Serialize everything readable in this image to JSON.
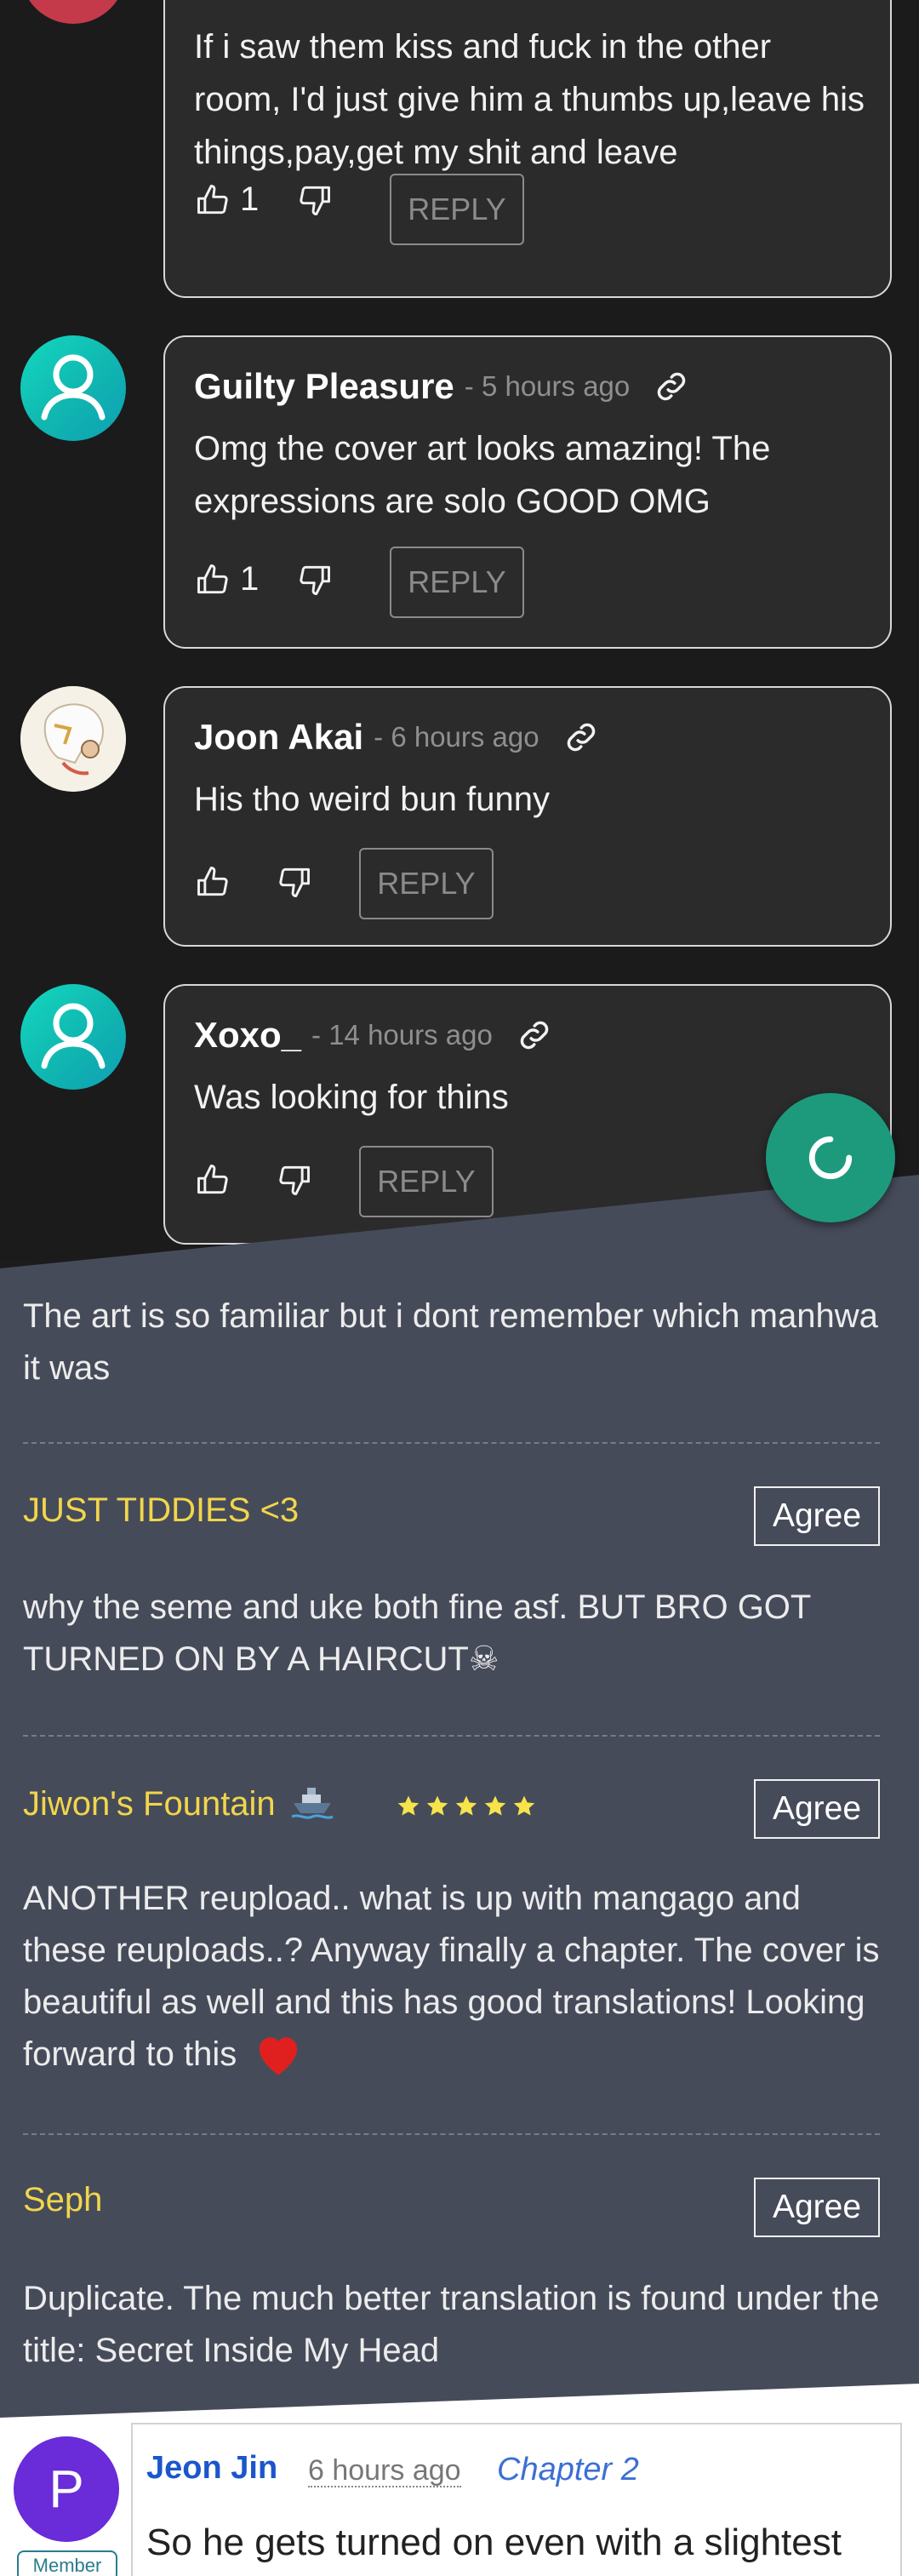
{
  "dark_comments": [
    {
      "author": "",
      "time": "",
      "text": "If i saw them kiss and fuck in the other room, I'd just give him a thumbs up,leave his things,pay,get my shit and leave",
      "likes": "1",
      "reply_label": "REPLY"
    },
    {
      "author": "Guilty Pleasure",
      "time": "- 5 hours ago",
      "text": "Omg the cover art looks amazing! The expressions are solo GOOD OMG",
      "likes": "1",
      "reply_label": "REPLY"
    },
    {
      "author": "Joon Akai",
      "time": "- 6 hours ago",
      "text": "His tho weird bun funny",
      "likes": "",
      "reply_label": "REPLY"
    },
    {
      "author": "Xoxo_",
      "time": "- 14 hours ago",
      "text": "Was looking for thins",
      "likes": "",
      "reply_label": "REPLY"
    }
  ],
  "slate_reviews": [
    {
      "name": "",
      "text": "The art is so familiar but i dont remember which manhwa it was"
    },
    {
      "name": "JUST TIDDIES <3",
      "agree_label": "Agree",
      "text": "why the seme and uke both fine asf. BUT BRO GOT TURNED ON BY A HAIRCUT",
      "emoji": "☠"
    },
    {
      "name": "Jiwon's Fountain",
      "rating": 5,
      "agree_label": "Agree",
      "text": "ANOTHER reupload.. what is up with mangago and these reuploads..? Anyway finally a chapter. The cover is beautiful as well and this has good translations! Looking forward to this"
    },
    {
      "name": "Seph",
      "agree_label": "Agree",
      "text": "Duplicate. The much better translation is found under the title: Secret Inside My Head"
    }
  ],
  "white_comment": {
    "avatar_letter": "P",
    "badge": "Member",
    "author": "Jeon Jin",
    "time": "6 hours ago",
    "chapter": "Chapter 2",
    "text": "So he gets turned on even with a slightest"
  },
  "colors": {
    "dark_bg": "#1b1b1b",
    "card_bg": "#2b2b2b",
    "slate_bg": "#464b5a",
    "name_yellow": "#f1d64b",
    "fab_green": "#1d9a7c",
    "avatar_purple": "#6a2bd8",
    "link_blue": "#1b56cc"
  },
  "icons": [
    "thumbs-up-icon",
    "thumbs-down-icon",
    "link-icon",
    "loading-icon",
    "user-icon",
    "ship-icon",
    "star-icon",
    "heart-icon"
  ]
}
